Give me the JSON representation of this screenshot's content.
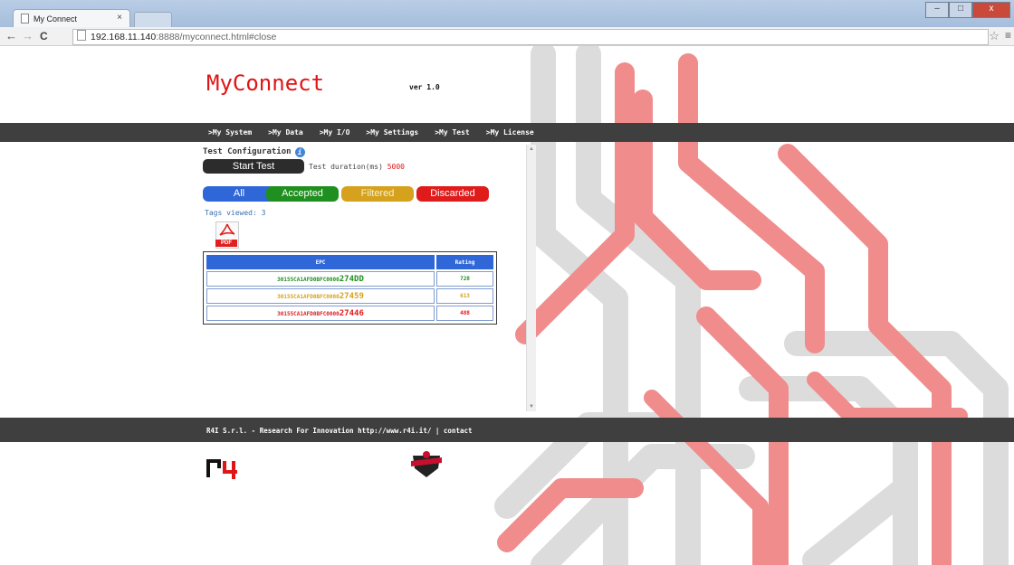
{
  "browser": {
    "tab_title": "My Connect",
    "tab_close": "×",
    "url_host": "192.168.11.140",
    "url_rest": ":8888/myconnect.html#close",
    "back": "←",
    "forward": "→",
    "reload": "C",
    "star": "☆",
    "menu": "≡"
  },
  "header": {
    "brand": "MyConnect",
    "version": "ver 1.0"
  },
  "nav": {
    "items": [
      ">My System",
      ">My Data",
      ">My I/O",
      ">My Settings",
      ">My Test",
      ">My License"
    ]
  },
  "test": {
    "title": "Test Configuration",
    "start_label": "Start Test",
    "duration_label": "Test duration(ms)",
    "duration_value": "5000"
  },
  "filters": {
    "all": "All",
    "accepted": "Accepted",
    "filtered": "Filtered",
    "discarded": "Discarded"
  },
  "tags_viewed": "Tags viewed: 3",
  "pdf_label": "PDF",
  "table": {
    "headers": [
      "EPC",
      "Rating"
    ],
    "rows": [
      {
        "epc_prefix": "30155CA1AFD0BFC0000",
        "epc_suffix": "274DD",
        "rating": "728",
        "status": "accepted"
      },
      {
        "epc_prefix": "30155CA1AFD0BFC0000",
        "epc_suffix": "27459",
        "rating": "613",
        "status": "filtered"
      },
      {
        "epc_prefix": "30155CA1AFD0BFC0000",
        "epc_suffix": "27446",
        "rating": "488",
        "status": "discarded"
      }
    ]
  },
  "footer": {
    "text": "R4I S.r.l. - Research For Innovation http://www.r4i.it/ | contact"
  },
  "colors": {
    "brand_red": "#e01515",
    "accepted": "#1f8f1f",
    "filtered": "#d6a21d",
    "discarded": "#e01b1b",
    "all": "#2f67d9"
  }
}
